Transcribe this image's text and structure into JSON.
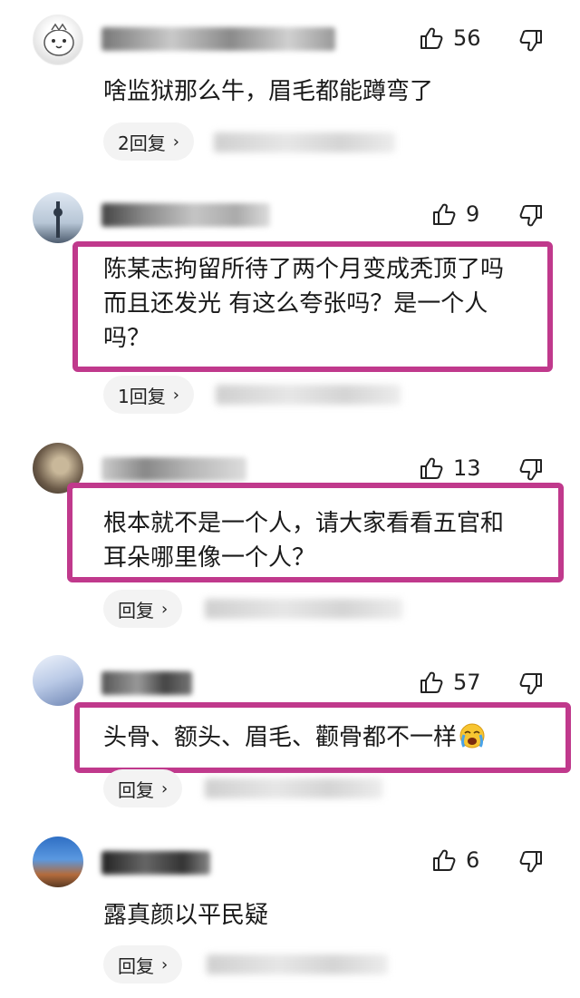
{
  "comments": [
    {
      "likes": "56",
      "text_lines": [
        "啥监狱那么牛，眉毛都能蹲弯了"
      ],
      "reply_label": "2回复",
      "reply_chevron": "›",
      "avatar_colors": [
        "#f0f0f0",
        "#d9d9d9"
      ]
    },
    {
      "likes": "9",
      "text_lines": [
        "陈某志拘留所待了两个月变成秃顶了吗",
        "而且还发光 有这么夸张吗？是一个人",
        "吗？"
      ],
      "reply_label": "1回复",
      "reply_chevron": "›",
      "highlighted": true,
      "avatar_colors": [
        "#c9d7e6",
        "#3c4a5c"
      ]
    },
    {
      "likes": "13",
      "text_lines": [
        "根本就不是一个人，请大家看看五官和",
        "耳朵哪里像一个人？"
      ],
      "reply_label": "回复",
      "reply_chevron": "›",
      "highlighted": true,
      "avatar_colors": [
        "#5a4a3c",
        "#b8a98f"
      ]
    },
    {
      "likes": "57",
      "text_lines": [
        "头骨、额头、眉毛、颧骨都不一样"
      ],
      "trailing_icon": "crying-face-emoji-icon",
      "reply_label": "回复",
      "reply_chevron": "›",
      "highlighted": true,
      "avatar_colors": [
        "#c8d6f0",
        "#7a8fb8"
      ]
    },
    {
      "likes": "6",
      "text_lines": [
        "露真颜以平民疑"
      ],
      "reply_label": "回复",
      "reply_chevron": "›",
      "avatar_colors": [
        "#3a78c8",
        "#b86a3a"
      ]
    }
  ],
  "icons": {
    "like": "thumbs-up-icon",
    "dislike": "thumbs-down-icon"
  },
  "colors": {
    "highlight_border": "#c0398c",
    "reply_pill_bg": "#f3f3f3",
    "text": "#1a1a1a"
  }
}
